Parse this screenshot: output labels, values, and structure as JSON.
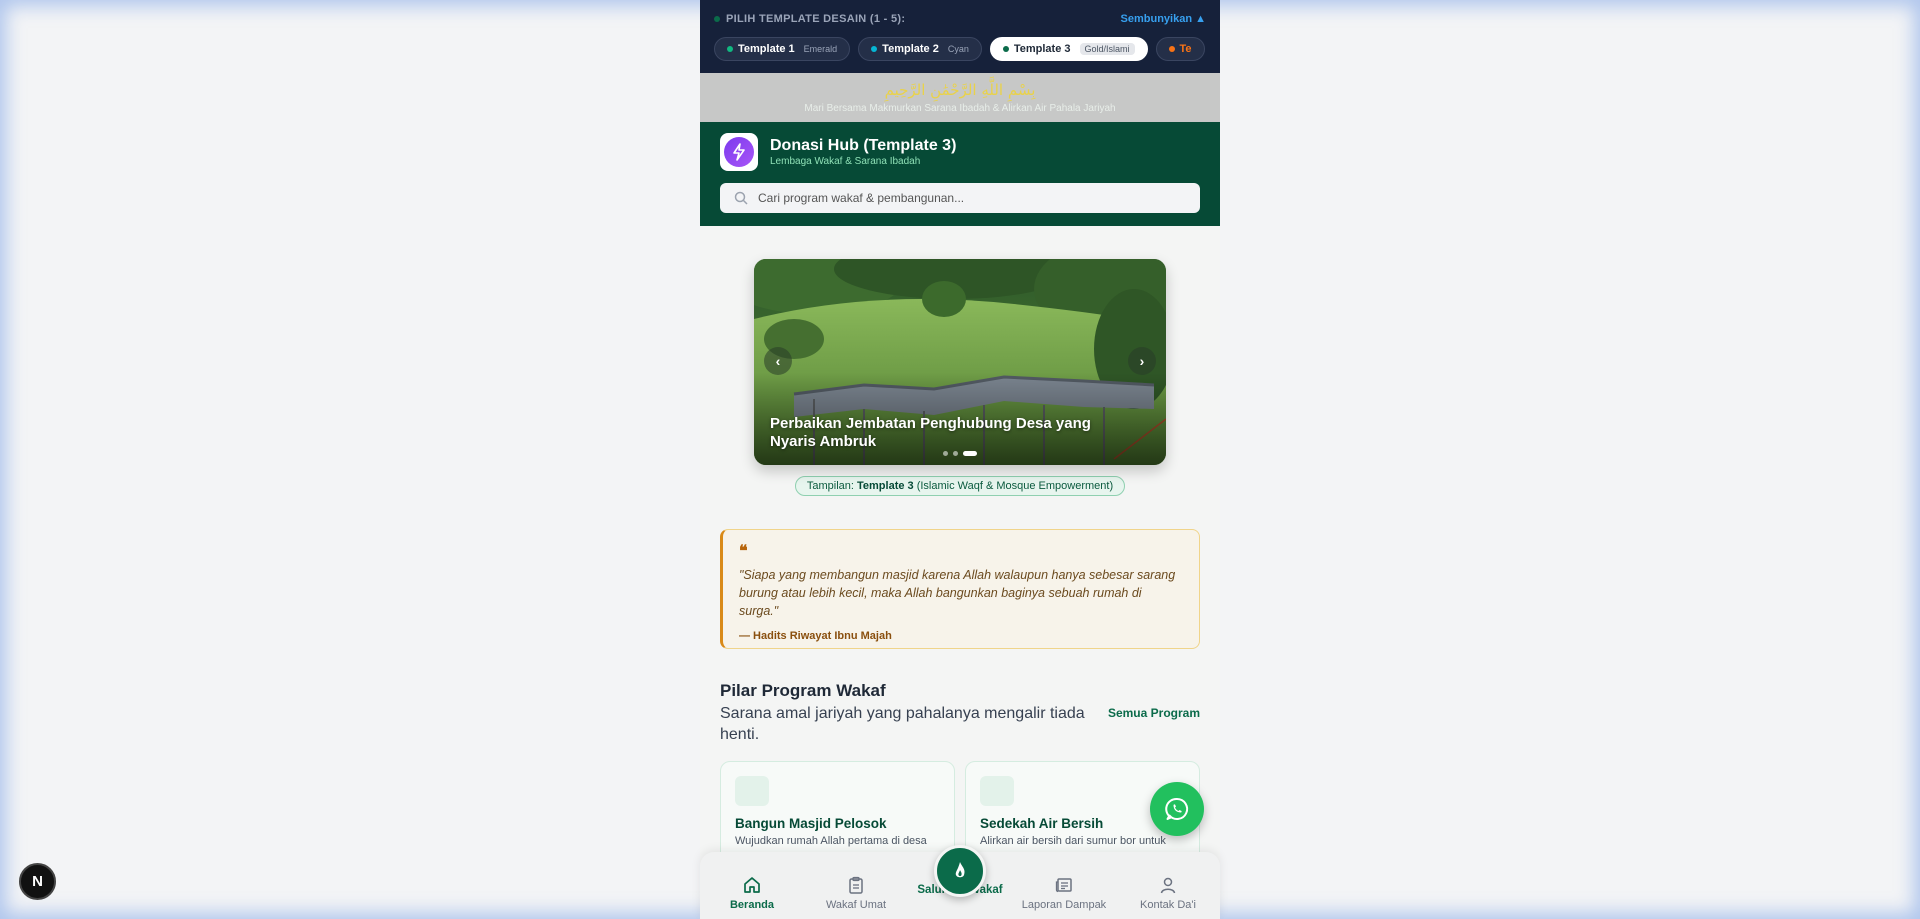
{
  "template_bar": {
    "title": "PILIH TEMPLATE DESAIN (1 - 5):",
    "hide_label": "Sembunyikan ▲",
    "chips": [
      {
        "name": "Template 1",
        "tag": "Emerald",
        "dot_color": "#10b981"
      },
      {
        "name": "Template 2",
        "tag": "Cyan",
        "dot_color": "#06b6d4"
      },
      {
        "name": "Template 3",
        "tag": "Gold/Islami",
        "dot_color": "#0b6b4a",
        "active": true
      },
      {
        "name": "Te",
        "tag": "",
        "dot_color": "#f97316"
      }
    ]
  },
  "bismillah": {
    "arabic": "بِسْمِ اللَّهِ الرَّحْمَٰنِ الرَّحِيمِ",
    "subtitle": "Mari Bersama Makmurkan Sarana Ibadah & Alirkan Air Pahala Jariyah"
  },
  "header": {
    "brand_name": "Donasi Hub (Template 3)",
    "brand_sub": "Lembaga Wakaf & Sarana Ibadah",
    "search_placeholder": "Cari program wakaf & pembangunan..."
  },
  "hero": {
    "title": "Perbaikan Jembatan Penghubung Desa yang Nyaris Ambruk",
    "prev": "‹",
    "next": "›",
    "active_slide": 3,
    "slide_count": 3
  },
  "tampilan": {
    "prefix": "Tampilan: ",
    "name": "Template 3",
    "suffix": " (Islamic Waqf & Mosque Empowerment)"
  },
  "hadith": {
    "quote_mark": "❝",
    "text": "\"Siapa yang membangun masjid karena Allah walaupun hanya sebesar sarang burung atau lebih kecil, maka Allah bangunkan baginya sebuah rumah di surga.\"",
    "source": "— Hadits Riwayat Ibnu Majah"
  },
  "pilar": {
    "title": "Pilar Program Wakaf",
    "subtitle": "Sarana amal jariyah yang pahalanya mengalir tiada henti.",
    "link": "Semua Program",
    "cards": [
      {
        "title": "Bangun Masjid Pelosok",
        "desc": "Wujudkan rumah Allah pertama di desa"
      },
      {
        "title": "Sedekah Air Bersih",
        "desc": "Alirkan air bersih dari sumur bor untuk"
      }
    ]
  },
  "bottom_nav": {
    "items": [
      {
        "label": "Beranda",
        "icon": "home-icon",
        "active": true
      },
      {
        "label": "Wakaf Umat",
        "icon": "clipboard-icon"
      },
      {
        "label": "Salurkan Wakaf",
        "icon": "flame-icon",
        "center": true
      },
      {
        "label": "Laporan Dampak",
        "icon": "newspaper-icon"
      },
      {
        "label": "Kontak Da'i",
        "icon": "user-icon"
      }
    ]
  },
  "badge": "N",
  "colors": {
    "brand_green": "#064a36",
    "accent_green": "#0b6b4a",
    "gold": "#d98a18",
    "whatsapp": "#22c05e"
  }
}
